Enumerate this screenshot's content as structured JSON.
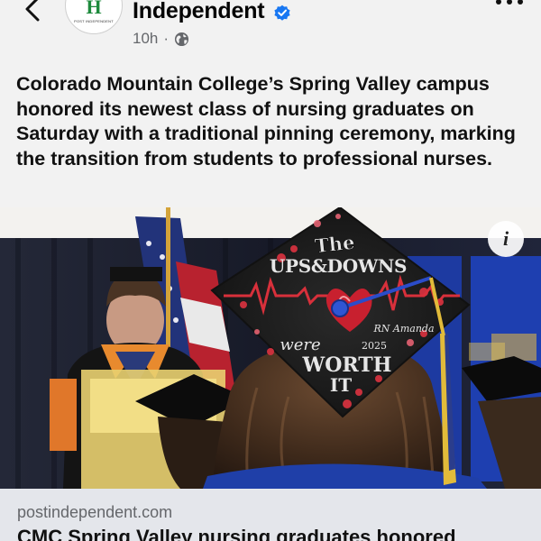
{
  "header": {
    "page_name": "Independent",
    "time": "10h",
    "avatar_letter": "H",
    "avatar_text": "POST INDEPENDENT",
    "icons": {
      "back": "chevron-left-icon",
      "verified": "verified-badge-icon",
      "privacy": "globe-icon",
      "more": "more-horizontal-icon"
    }
  },
  "post": {
    "caption": "Colorado Mountain College’s Spring Valley campus honored its newest class of nursing graduates on Saturday with a traditional pinning ceremony, marking the transition from students to professional nurses."
  },
  "media": {
    "info_glyph": "i",
    "cap_text": {
      "line1": "The",
      "line2": "UPS&DOWNS",
      "name": "RN Amanda",
      "year": "2025",
      "line3": "were",
      "line4": "WORTH",
      "line5": "IT"
    }
  },
  "link": {
    "domain": "postindependent.com",
    "headline": "CMC Spring Valley nursing graduates honored"
  },
  "colors": {
    "verified_blue": "#1877f2",
    "secondary_text": "#65676b",
    "card_bg": "#e4e6eb"
  }
}
